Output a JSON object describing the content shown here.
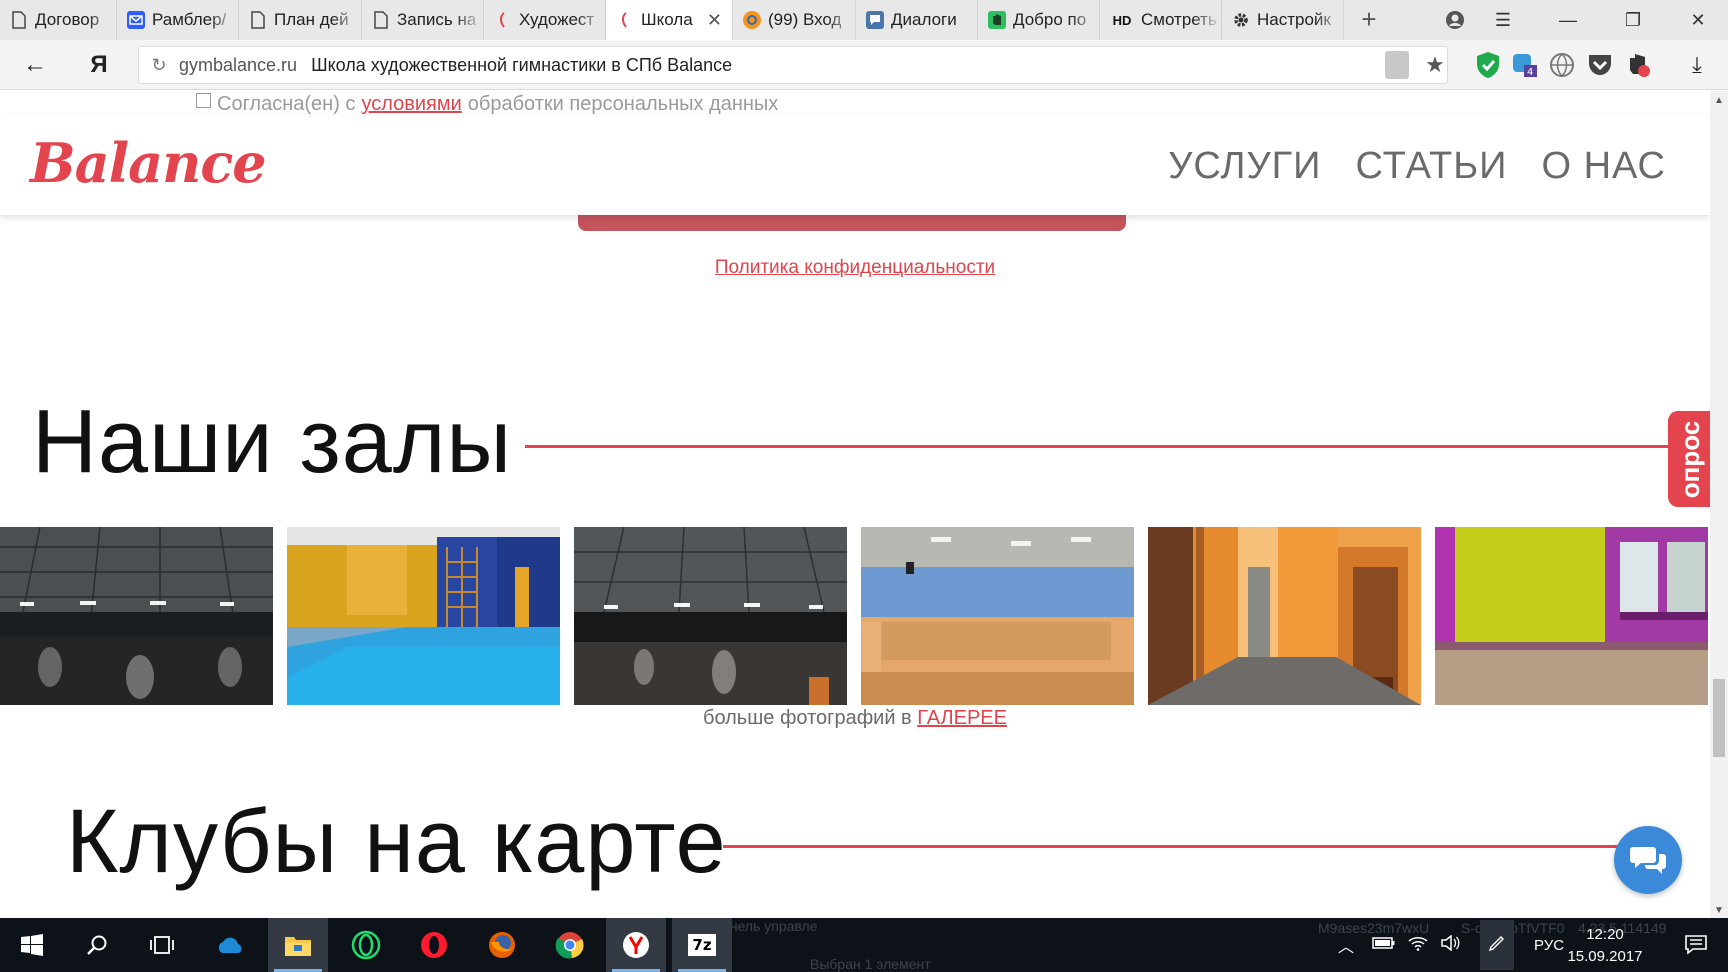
{
  "browser": {
    "tabs": [
      {
        "label": "Договор",
        "icon": "document-icon",
        "active": false
      },
      {
        "label": "Рамблер/",
        "icon": "mail-icon",
        "active": false
      },
      {
        "label": "План дей",
        "icon": "document-icon",
        "active": false
      },
      {
        "label": "Запись на",
        "icon": "document-icon",
        "active": false
      },
      {
        "label": "Художест",
        "icon": "balance-favicon",
        "active": false
      },
      {
        "label": "Школа",
        "icon": "balance-favicon",
        "active": true
      },
      {
        "label": "(99) Вход",
        "icon": "odnoklassniki-icon",
        "active": false
      },
      {
        "label": "Диалоги",
        "icon": "chat-icon",
        "active": false
      },
      {
        "label": "Добро по",
        "icon": "evernote-icon",
        "active": false
      },
      {
        "label": "Смотреть",
        "icon": "hd-icon",
        "icon_text": "HD",
        "active": false
      },
      {
        "label": "Настройк",
        "icon": "gear-icon",
        "active": false
      }
    ],
    "url_host": "gymbalance.ru",
    "page_title": "Школа художественной гимнастики в СПб Balance",
    "yandex_glyph": "Я"
  },
  "page": {
    "consent": {
      "before": "Согласна(ен) с",
      "link": "условиями",
      "after": "обработки персональных данных"
    },
    "logo": "Balance",
    "nav": [
      "УСЛУГИ",
      "СТАТЬИ",
      "О НАС"
    ],
    "privacy_link": "Политика конфиденциальности",
    "halls_heading": "Наши залы",
    "more_photos_text": "больше фотографий в",
    "more_photos_link": "ГАЛЕРЕЕ",
    "clubs_heading": "Клубы на карте",
    "survey_tab": "опрос",
    "accent_color": "#e3444d"
  },
  "taskbar": {
    "pinned": [
      "windows-start-icon",
      "search-icon",
      "task-view-icon",
      "onedrive-icon",
      "file-explorer-icon",
      "opera-neon-icon",
      "opera-icon",
      "firefox-icon",
      "chrome-icon",
      "yandex-browser-icon",
      "7zip-icon"
    ],
    "sevenzip_label": "7z",
    "language": "РУС",
    "time": "12:20",
    "date": "15.09.2017",
    "ghost_texts": [
      "Панель управле",
      "M9ases23m7wxU",
      "S-dkNUbTfVTF0",
      "4.23.5.114149",
      "Выбран 1 элемент"
    ]
  }
}
